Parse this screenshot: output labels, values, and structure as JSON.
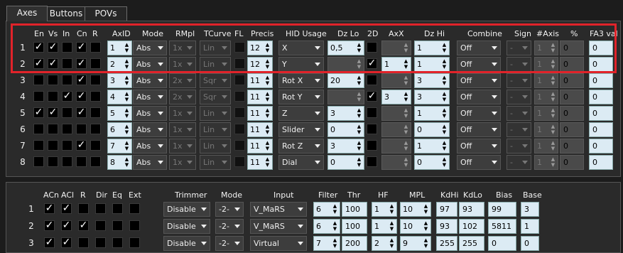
{
  "tabs": [
    "Axes",
    "Buttons",
    "POVs"
  ],
  "axes": {
    "headers": {
      "en": "En",
      "vs": "Vs",
      "in": "In",
      "cn": "Cn",
      "r": "R",
      "axid": "AxID",
      "mode": "Mode",
      "rmpl": "RMpl",
      "tcurve": "TCurve",
      "fl": "FL",
      "precis": "Precis",
      "hid": "HID Usage",
      "dzlo": "Dz Lo",
      "d2": "2D",
      "axx": "AxX",
      "dzhi": "Dz Hi",
      "combine": "Combine",
      "sign": "Sign",
      "naxis": "#Axis",
      "pct": "%",
      "fa3": "FA3 val"
    },
    "rows": [
      {
        "num": "1",
        "en": true,
        "vs": true,
        "in": false,
        "cn": true,
        "r": false,
        "axid": "1",
        "mode": "Abs",
        "rmpl": "1x",
        "tcurve": "Lin",
        "precis": "12",
        "hid": "X",
        "dzlo": "0,5",
        "d2": false,
        "axx": "",
        "dzhi": "1",
        "combine": "Off",
        "sign": "-",
        "naxis": "1",
        "pct": "0",
        "fa3": "0"
      },
      {
        "num": "2",
        "en": true,
        "vs": true,
        "in": false,
        "cn": true,
        "r": false,
        "axid": "2",
        "mode": "Abs",
        "rmpl": "1x",
        "tcurve": "Lin",
        "precis": "12",
        "hid": "Y",
        "dzlo": "",
        "d2": true,
        "axx": "1",
        "dzhi": "1",
        "combine": "Off",
        "sign": "-",
        "naxis": "1",
        "pct": "0",
        "fa3": "0"
      },
      {
        "num": "3",
        "en": false,
        "vs": false,
        "in": false,
        "cn": true,
        "r": false,
        "axid": "3",
        "mode": "Abs",
        "rmpl": "2x",
        "tcurve": "Sqr",
        "precis": "11",
        "hid": "Rot X",
        "dzlo": "20",
        "d2": false,
        "axx": "",
        "dzhi": "3",
        "combine": "Off",
        "sign": "-",
        "naxis": "1",
        "pct": "0",
        "fa3": "0"
      },
      {
        "num": "4",
        "en": false,
        "vs": false,
        "in": true,
        "cn": true,
        "r": false,
        "axid": "4",
        "mode": "Abs",
        "rmpl": "2x",
        "tcurve": "Sqr",
        "precis": "11",
        "hid": "Rot Y",
        "dzlo": "",
        "d2": true,
        "axx": "3",
        "dzhi": "3",
        "combine": "Off",
        "sign": "-",
        "naxis": "1",
        "pct": "0",
        "fa3": "0"
      },
      {
        "num": "5",
        "en": true,
        "vs": true,
        "in": false,
        "cn": true,
        "r": false,
        "axid": "5",
        "mode": "Abs",
        "rmpl": "1x",
        "tcurve": "Lin",
        "precis": "11",
        "hid": "Z",
        "dzlo": "3",
        "d2": false,
        "axx": "",
        "dzhi": "1",
        "combine": "Off",
        "sign": "-",
        "naxis": "1",
        "pct": "0",
        "fa3": "0"
      },
      {
        "num": "6",
        "en": false,
        "vs": false,
        "in": false,
        "cn": false,
        "r": false,
        "axid": "6",
        "mode": "Abs",
        "rmpl": "1x",
        "tcurve": "Lin",
        "precis": "11",
        "hid": "Slider",
        "dzlo": "0",
        "d2": false,
        "axx": "",
        "dzhi": "0",
        "combine": "Off",
        "sign": "-",
        "naxis": "1",
        "pct": "0",
        "fa3": "0"
      },
      {
        "num": "7",
        "en": false,
        "vs": false,
        "in": false,
        "cn": true,
        "r": false,
        "axid": "7",
        "mode": "Abs",
        "rmpl": "1x",
        "tcurve": "Lin",
        "precis": "11",
        "hid": "Rot Z",
        "dzlo": "3",
        "d2": false,
        "axx": "",
        "dzhi": "1",
        "combine": "Off",
        "sign": "-",
        "naxis": "1",
        "pct": "0",
        "fa3": "0"
      },
      {
        "num": "8",
        "en": false,
        "vs": false,
        "in": false,
        "cn": false,
        "r": false,
        "axid": "8",
        "mode": "Abs",
        "rmpl": "1x",
        "tcurve": "Lin",
        "precis": "11",
        "hid": "Dial",
        "dzlo": "0",
        "d2": false,
        "axx": "",
        "dzhi": "0",
        "combine": "Off",
        "sign": "-",
        "naxis": "1",
        "pct": "0",
        "fa3": "0"
      }
    ]
  },
  "filters": {
    "headers": {
      "acn": "ACn",
      "acl": "ACl",
      "r": "R",
      "dir": "Dir",
      "eq": "Eq",
      "ext": "Ext",
      "trimmer": "Trimmer",
      "mode": "Mode",
      "input": "Input",
      "filter": "Filter",
      "thr": "Thr",
      "hf": "HF",
      "mpl": "MPL",
      "kdhi": "KdHi",
      "kdlo": "KdLo",
      "bias": "Bias",
      "base": "Base"
    },
    "rows": [
      {
        "num": "1",
        "acn": true,
        "acl": true,
        "r": false,
        "dir": false,
        "eq": false,
        "ext": false,
        "trimmer": "Disable",
        "mode": "-2-",
        "input": "V_MaRS",
        "filter": "6",
        "thr": "100",
        "hf": "1",
        "mpl": "10",
        "kdhi": "97",
        "kdlo": "93",
        "bias": "99",
        "base": "3"
      },
      {
        "num": "2",
        "acn": true,
        "acl": true,
        "r": true,
        "dir": false,
        "eq": false,
        "ext": false,
        "trimmer": "Disable",
        "mode": "-2-",
        "input": "V_MaRS",
        "filter": "6",
        "thr": "100",
        "hf": "1",
        "mpl": "10",
        "kdhi": "93",
        "kdlo": "102",
        "bias": "5811",
        "base": "1"
      },
      {
        "num": "3",
        "acn": true,
        "acl": true,
        "r": false,
        "dir": false,
        "eq": false,
        "ext": false,
        "trimmer": "Disable",
        "mode": "-2-",
        "input": "Virtual",
        "filter": "7",
        "thr": "200",
        "hf": "2",
        "mpl": "9",
        "kdhi": "255",
        "kdlo": "255",
        "bias": "0",
        "base": "0"
      }
    ]
  },
  "check_glyph": "✓",
  "colors": {
    "highlight": "#e1232a",
    "field": "#dcebf4",
    "background": "#1c1c1c"
  }
}
